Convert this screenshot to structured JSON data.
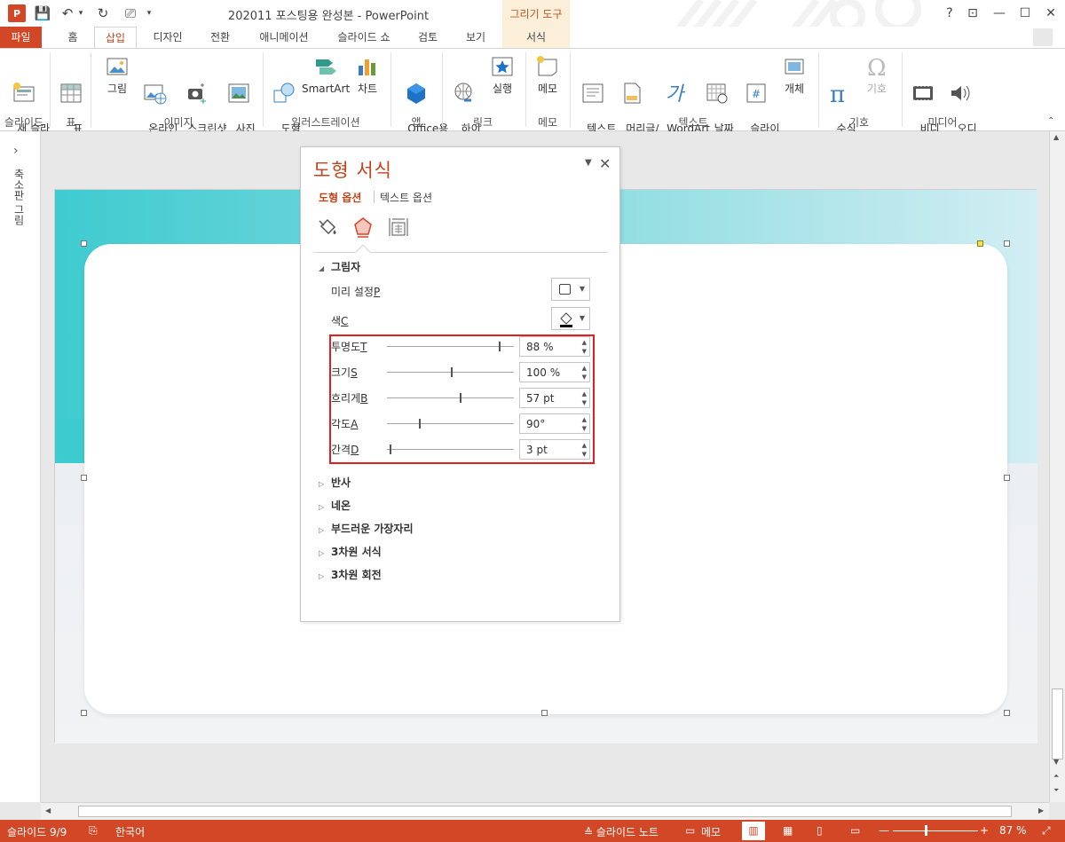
{
  "window": {
    "title": "202011 포스팅용 완성본 - PowerPoint",
    "app_icon": "P",
    "contextual_group": "그리기 도구",
    "help": "?",
    "restore_ribbon": "⊡",
    "minimize": "—",
    "maximize": "☐",
    "close": "✕"
  },
  "qat": {
    "save": "💾",
    "undo": "↶",
    "undo_more": "▾",
    "redo": "↻",
    "presenter": "⎚",
    "customize": "▾"
  },
  "tabs": [
    {
      "label": "파일"
    },
    {
      "label": "홈"
    },
    {
      "label": "삽입"
    },
    {
      "label": "디자인"
    },
    {
      "label": "전환"
    },
    {
      "label": "애니메이션"
    },
    {
      "label": "슬라이드 쇼"
    },
    {
      "label": "검토"
    },
    {
      "label": "보기"
    },
    {
      "label": "서식"
    }
  ],
  "ribbon": {
    "new_slide": "새 슬라\n이드 ▾",
    "table": "표\n▾",
    "picture": "그림",
    "online_picture": "온라인\n그림",
    "screenshot": "스크린샷\n▾",
    "photo_album": "사진\n앨범 ▾",
    "shapes": "도형\n▾",
    "smartart": "SmartArt",
    "chart": "차트",
    "office_apps": "Office용\n앱 ▾",
    "hyperlink": "하이\n퍼링크",
    "action": "실행",
    "comment": "메모",
    "textbox": "텍스트\n상자 ▾",
    "header_footer": "머리글/\n바닥글",
    "wordart": "WordArt\n▾",
    "date_time": "날짜\n및 시간",
    "slide_number": "슬라이\n드 번호",
    "object": "개체",
    "equation": "수식\n▾",
    "symbol": "기호",
    "video": "비디\n오 ▾",
    "audio": "오디\n오 ▾",
    "groups": {
      "slides": "슬라이드",
      "tables": "표",
      "images": "이미지",
      "illustrations": "일러스트레이션",
      "apps": "앱",
      "links": "링크",
      "comments": "메모",
      "text": "텍스트",
      "symbols": "기호",
      "media": "미디어"
    }
  },
  "thumb_pane": {
    "chevron": "›",
    "label": "축소판 그림"
  },
  "format_pane": {
    "title": "도형 서식",
    "tab_shape": "도형 옵션",
    "tab_text": "텍스트 옵션",
    "shadow": {
      "heading": "그림자",
      "preset_label": "미리 설정",
      "preset_key": "P",
      "color_label": "색",
      "color_key": "C",
      "transparency_label": "투명도",
      "transparency_key": "T",
      "transparency_value": "88 %",
      "transparency_level": 0.88,
      "size_label": "크기",
      "size_key": "S",
      "size_value": "100 %",
      "size_level": 0.5,
      "blur_label": "흐리게",
      "blur_key": "B",
      "blur_value": "57 pt",
      "blur_level": 0.57,
      "angle_label": "각도",
      "angle_key": "A",
      "angle_value": "90°",
      "angle_level": 0.25,
      "distance_label": "간격",
      "distance_key": "D",
      "distance_value": "3 pt",
      "distance_level": 0.02
    },
    "sections": [
      {
        "label": "반사"
      },
      {
        "label": "네온"
      },
      {
        "label": "부드러운 가장자리"
      },
      {
        "label": "3차원 서식"
      },
      {
        "label": "3차원 회전"
      }
    ]
  },
  "status": {
    "slide": "슬라이드 9/9",
    "language": "한국어",
    "notes": "≙ 슬라이드 노트",
    "comments": "메모",
    "zoom": "87 %"
  },
  "colors": {
    "accent": "#d24726",
    "teal": "#3ecbd0",
    "highlight": "#e02020"
  }
}
